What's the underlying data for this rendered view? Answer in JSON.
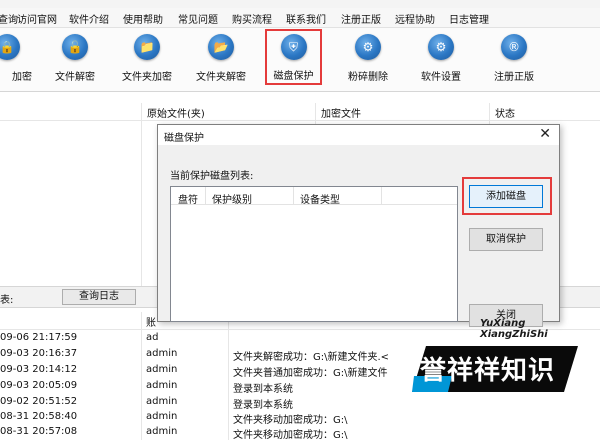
{
  "menubar": {
    "items": [
      "查询",
      "访问官网",
      "软件介绍",
      "使用帮助",
      "常见问题",
      "购买流程",
      "联系我们",
      "注册正版",
      "远程协助",
      "日志管理"
    ]
  },
  "toolbar": {
    "buttons": [
      {
        "label": "加密",
        "icon": "lock-icon"
      },
      {
        "label": "文件解密",
        "icon": "unlock-icon"
      },
      {
        "label": "文件夹加密",
        "icon": "folder-lock-icon"
      },
      {
        "label": "文件夹解密",
        "icon": "folder-unlock-icon"
      },
      {
        "label": "磁盘保护",
        "icon": "shield-icon"
      },
      {
        "label": "粉碎删除",
        "icon": "shredder-icon"
      },
      {
        "label": "软件设置",
        "icon": "gear-icon"
      },
      {
        "label": "注册正版",
        "icon": "registered-icon"
      }
    ],
    "active": "磁盘保护"
  },
  "file_table": {
    "columns": [
      "原始文件(夹)",
      "加密文件",
      "状态"
    ]
  },
  "log_bar": {
    "label": "表:",
    "query_button": "查询日志"
  },
  "log_table": {
    "user_header": "账",
    "rows": [
      {
        "time": "09-06 21:17:59",
        "user": "ad",
        "message": ""
      },
      {
        "time": "09-03 20:16:37",
        "user": "admin",
        "message": "文件夹解密成功：G:\\新建文件夹.<"
      },
      {
        "time": "09-03 20:14:12",
        "user": "admin",
        "message": "文件夹普通加密成功：G:\\新建文件"
      },
      {
        "time": "09-03 20:05:09",
        "user": "admin",
        "message": "登录到本系统"
      },
      {
        "time": "09-02 20:51:52",
        "user": "admin",
        "message": "登录到本系统"
      },
      {
        "time": "08-31 20:58:40",
        "user": "admin",
        "message": "文件夹移动加密成功：G:\\"
      },
      {
        "time": "08-31 20:57:08",
        "user": "admin",
        "message": "文件夹移动加密成功：G:\\"
      }
    ]
  },
  "dialog": {
    "title": "磁盘保护",
    "caption": "当前保护磁盘列表:",
    "columns": [
      "盘符",
      "保护级别",
      "设备类型"
    ],
    "buttons": {
      "add": "添加磁盘",
      "cancel": "取消保护",
      "close": "关闭"
    }
  },
  "watermark": {
    "line1": "YuXiang",
    "line2": "XiangZhiShi",
    "main": "誉祥祥知识",
    "colors": {
      "block": "#0a0a0a",
      "accent": "#0096d6"
    }
  },
  "colors": {
    "highlight_red": "#e43b3b",
    "accent_blue": "#2b77c4"
  }
}
